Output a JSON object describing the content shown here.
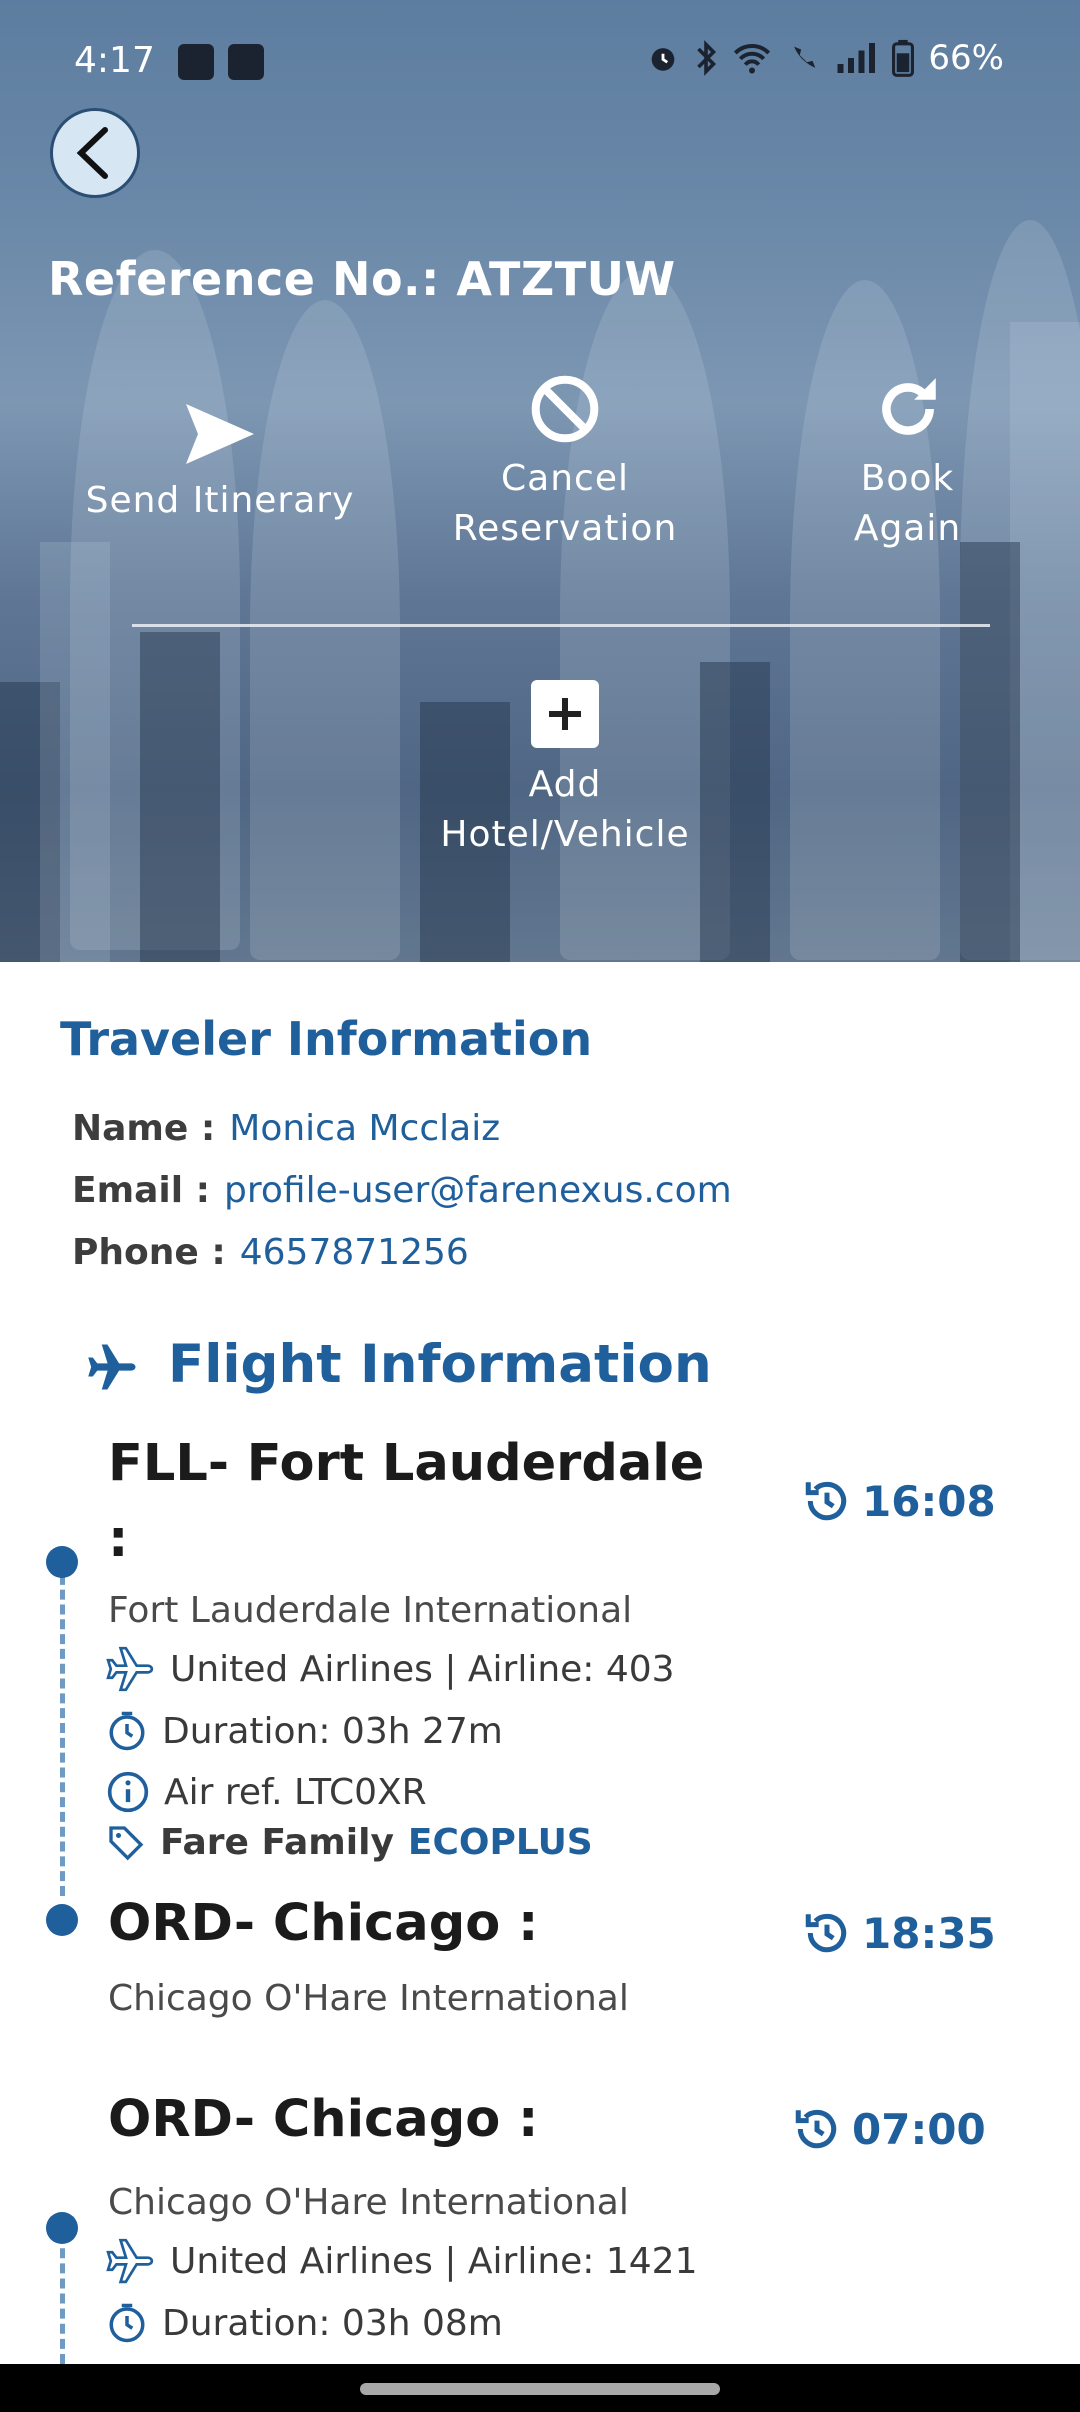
{
  "status_bar": {
    "time": "4:17",
    "battery": "66%",
    "icons": [
      "teams-icon",
      "outlook-icon",
      "alarm-icon",
      "bluetooth-icon",
      "wifi-icon",
      "wifi-call-icon",
      "signal-icon",
      "battery-icon"
    ]
  },
  "header": {
    "reference": "Reference No.: ATZTUW",
    "actions": {
      "send": "Send Itinerary",
      "cancel_line1": "Cancel",
      "cancel_line2": "Reservation",
      "book_line1": "Book",
      "book_line2": "Again",
      "add_line1": "Add",
      "add_line2": "Hotel/Vehicle"
    }
  },
  "traveler": {
    "title": "Traveler Information",
    "name_label": "Name :",
    "name": "Monica Mcclaiz",
    "email_label": "Email :",
    "email": "profile-user@farenexus.com",
    "phone_label": "Phone :",
    "phone": "4657871256"
  },
  "flight": {
    "title": "Flight Information",
    "segments": [
      {
        "from_title_line1": "FLL- Fort Lauderdale",
        "from_title_line2": ":",
        "from_airport": "Fort Lauderdale International",
        "depart_time": "16:08",
        "airline": "United Airlines | Airline: 403",
        "duration": "Duration: 03h 27m",
        "air_ref": "Air ref. LTC0XR",
        "fare_family_label": "Fare Family",
        "fare_family": "ECOPLUS",
        "to_title": "ORD- Chicago :",
        "to_airport": "Chicago O'Hare International",
        "arrive_time": "18:35"
      },
      {
        "from_title": "ORD- Chicago :",
        "from_airport": "Chicago O'Hare International",
        "depart_time": "07:00",
        "airline": "United Airlines | Airline: 1421",
        "duration": "Duration: 03h 08m"
      }
    ]
  },
  "colors": {
    "accent": "#1f5f9c",
    "timeline_dash": "#6f9ac4",
    "hero_top": "#5d7da0",
    "hero_bottom": "#62778f"
  }
}
